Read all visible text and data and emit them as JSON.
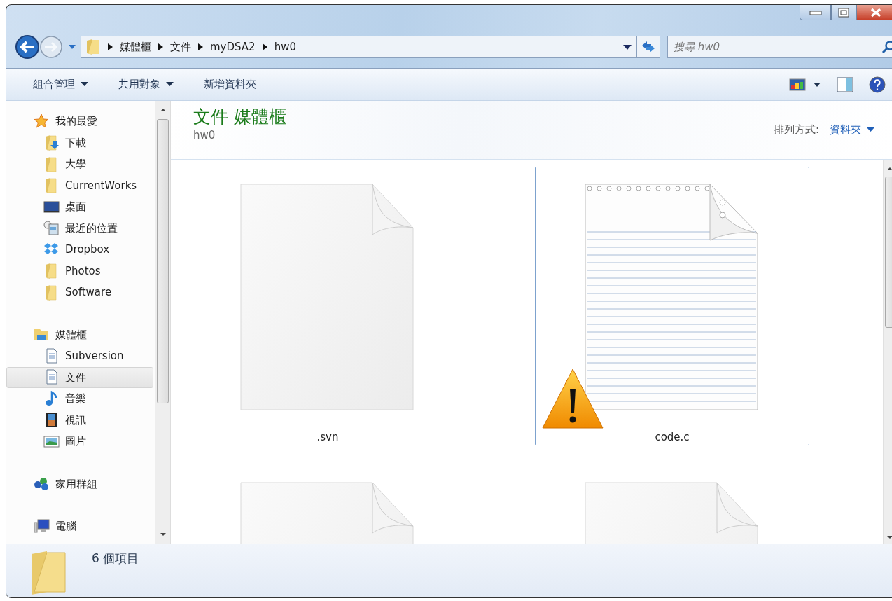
{
  "address": {
    "breadcrumbs": [
      "媒體櫃",
      "文件",
      "myDSA2",
      "hw0"
    ]
  },
  "search": {
    "placeholder": "搜尋 hw0"
  },
  "toolbar": {
    "buttons": [
      {
        "label": "組合管理",
        "dropdown": true
      },
      {
        "label": "共用對象",
        "dropdown": true
      },
      {
        "label": "新增資料夾",
        "dropdown": false
      }
    ]
  },
  "sidebar": {
    "groups": [
      {
        "label": "我的最愛",
        "kind": "star",
        "children": [
          {
            "label": "下載",
            "kind": "download",
            "selected": false
          },
          {
            "label": "大學",
            "kind": "folder",
            "selected": false
          },
          {
            "label": "CurrentWorks",
            "kind": "folder",
            "selected": false
          },
          {
            "label": "桌面",
            "kind": "desktop",
            "selected": false
          },
          {
            "label": "最近的位置",
            "kind": "recent",
            "selected": false
          },
          {
            "label": "Dropbox",
            "kind": "dropbox",
            "selected": false
          },
          {
            "label": "Photos",
            "kind": "folder",
            "selected": false
          },
          {
            "label": "Software",
            "kind": "folder",
            "selected": false
          }
        ]
      },
      {
        "label": "媒體櫃",
        "kind": "library",
        "children": [
          {
            "label": "Subversion",
            "kind": "document",
            "selected": false
          },
          {
            "label": "文件",
            "kind": "document",
            "selected": true
          },
          {
            "label": "音樂",
            "kind": "music",
            "selected": false
          },
          {
            "label": "視訊",
            "kind": "video",
            "selected": false
          },
          {
            "label": "圖片",
            "kind": "picture",
            "selected": false
          }
        ]
      },
      {
        "label": "家用群組",
        "kind": "homegroup"
      },
      {
        "label": "電腦",
        "kind": "computer"
      }
    ]
  },
  "content": {
    "title": "文件 媒體櫃",
    "subtitle": "hw0",
    "arrange_label": "排列方式:",
    "arrange_value": "資料夾",
    "files": [
      {
        "name": ".svn",
        "kind": "blank",
        "selected": false,
        "warning": false
      },
      {
        "name": "code.c",
        "kind": "text",
        "selected": true,
        "warning": true
      },
      {
        "kind": "blank",
        "selected": false,
        "warning": false
      },
      {
        "kind": "blank",
        "selected": false,
        "warning": false
      }
    ]
  },
  "status_bar": {
    "count": "6 個項目"
  }
}
